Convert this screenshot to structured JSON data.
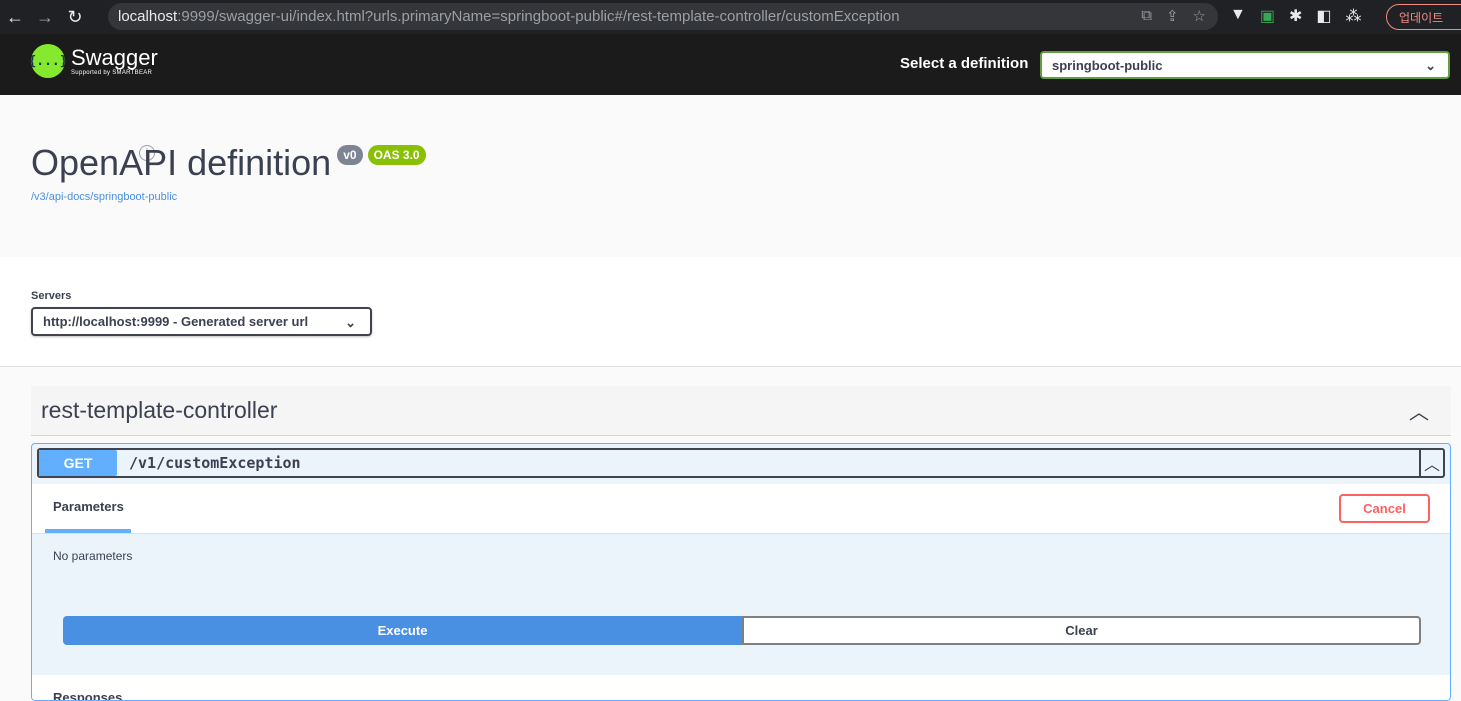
{
  "browser": {
    "url_host": "localhost",
    "url_path": ":9999/swagger-ui/index.html?urls.primaryName=springboot-public#/rest-template-controller/customException",
    "update_label": "업데이트"
  },
  "topbar": {
    "logo_glyph": "{...}",
    "logo_name": "Swagger",
    "logo_sub": "Supported by SMARTBEAR",
    "definition_label": "Select a definition",
    "definition_value": "springboot-public"
  },
  "info": {
    "title": "OpenAPI definition",
    "version": "v0",
    "oas": "OAS 3.0",
    "api_link": "/v3/api-docs/springboot-public"
  },
  "servers": {
    "label": "Servers",
    "selected": "http://localhost:9999 - Generated server url"
  },
  "tag": {
    "name": "rest-template-controller"
  },
  "operation": {
    "method": "GET",
    "path": "/v1/customException",
    "parameters_tab": "Parameters",
    "cancel_label": "Cancel",
    "no_params": "No parameters",
    "execute_label": "Execute",
    "clear_label": "Clear",
    "responses_label": "Responses"
  },
  "colors": {
    "get_blue": "#61affe",
    "execute_blue": "#4990e2",
    "cancel_red": "#ff6060",
    "oas_green": "#89bf04"
  }
}
